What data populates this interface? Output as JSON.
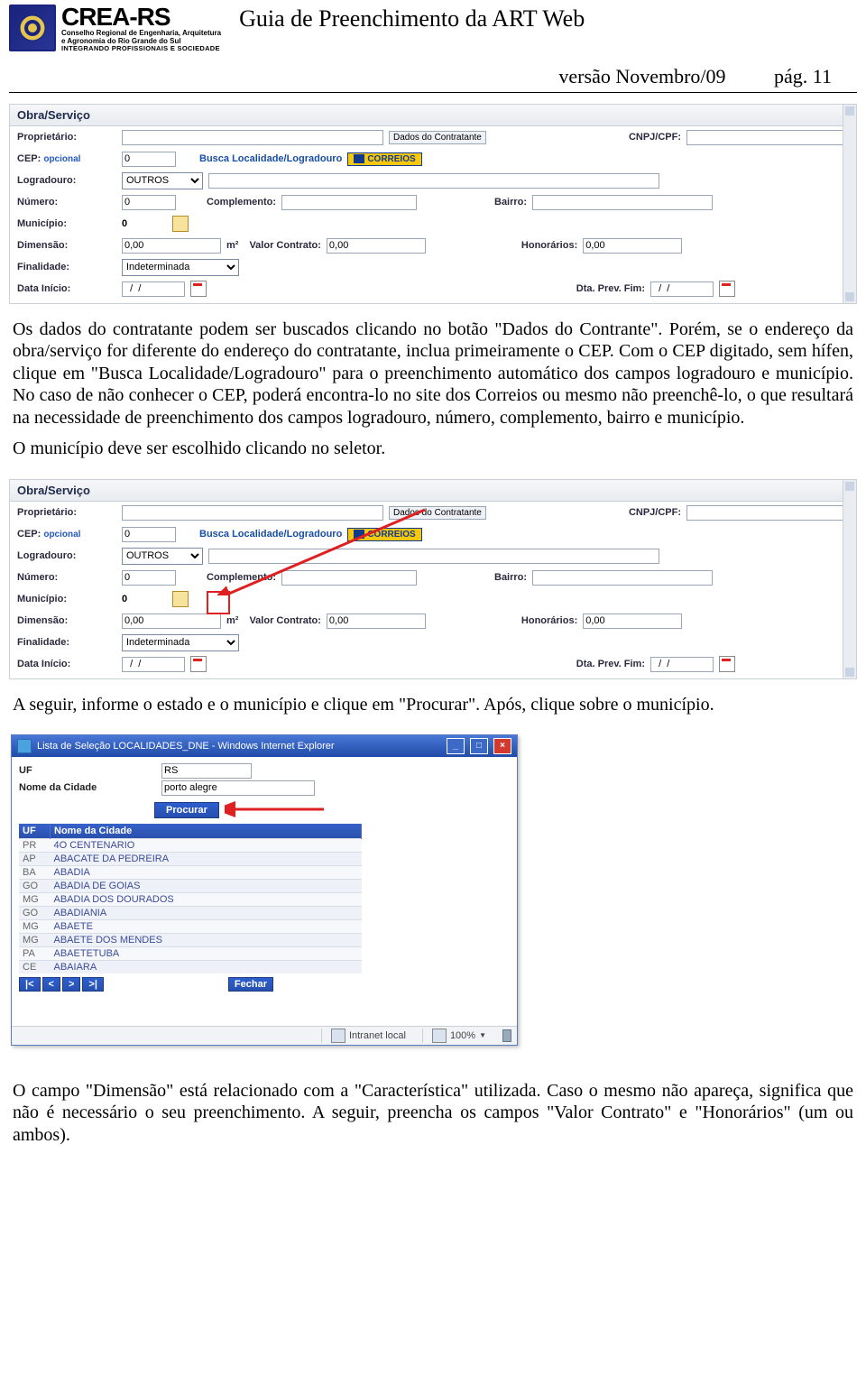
{
  "header": {
    "logo_main": "CREA-RS",
    "logo_sub1": "Conselho Regional de Engenharia, Arquitetura",
    "logo_sub2": "e Agronomia do Rio Grande do Sul",
    "logo_tagline": "INTEGRANDO PROFISSIONAIS E SOCIEDADE",
    "doc_title": "Guia de Preenchimento da ART Web",
    "version_text": "versão Novembro/09",
    "page_text": "pág. 11"
  },
  "form": {
    "section_title": "Obra/Serviço",
    "labels": {
      "proprietario": "Proprietário:",
      "cnpj_cpf": "CNPJ/CPF:",
      "cep": "CEP:",
      "cep_opt": "opcional",
      "busca_local": "Busca Localidade/Logradouro",
      "correios": "CORREIOS",
      "logradouro": "Logradouro:",
      "numero": "Número:",
      "complemento": "Complemento:",
      "bairro": "Bairro:",
      "municipio": "Município:",
      "dimensao": "Dimensão:",
      "m2": "m²",
      "valor_contrato": "Valor Contrato:",
      "honorarios": "Honorários:",
      "finalidade": "Finalidade:",
      "data_inicio": "Data Início:",
      "dta_prev_fim": "Dta. Prev. Fim:",
      "dados_contratante": "Dados do Contratante"
    },
    "values": {
      "cep": "0",
      "logradouro_tipo": "OUTROS",
      "numero": "0",
      "municipio": "0",
      "dimensao": "0,00",
      "valor_contrato": "0,00",
      "honorarios": "0,00",
      "finalidade": "Indeterminada",
      "data_inicio": "  /  /",
      "dta_prev_fim": "  /  /"
    }
  },
  "paragraphs": {
    "p1": "Os dados do contratante podem ser buscados clicando no botão \"Dados do Contrante\". Porém, se o endereço da obra/serviço for diferente do endereço do contratante, inclua primeiramente o CEP. Com o CEP digitado, sem hífen, clique em \"Busca Localidade/Logradouro\" para o preenchimento automático dos campos logradouro e município. No caso de não conhecer o CEP, poderá encontra-lo no site dos Correios ou mesmo não preenchê-lo, o que resultará na necessidade de preenchimento dos campos logradouro, número, complemento, bairro e município.",
    "p2": "O município deve ser escolhido clicando no seletor.",
    "p3": "A seguir, informe o estado e o município e clique em \"Procurar\".  Após, clique sobre o município.",
    "p4": "O campo \"Dimensão\" está relacionado com a \"Característica\" utilizada. Caso o mesmo não apareça, significa que não é necessário o seu preenchimento. A seguir, preencha os campos \"Valor Contrato\" e \"Honorários\" (um ou ambos)."
  },
  "popup": {
    "title": "Lista de Seleção LOCALIDADES_DNE - Windows Internet Explorer",
    "labels": {
      "uf": "UF",
      "nome_cidade": "Nome da Cidade",
      "procurar": "Procurar",
      "fechar": "Fechar"
    },
    "values": {
      "uf": "RS",
      "nome_cidade": "porto alegre"
    },
    "headers": [
      "UF",
      "Nome da Cidade"
    ],
    "rows": [
      [
        "PR",
        "4O CENTENARIO"
      ],
      [
        "AP",
        "ABACATE DA PEDREIRA"
      ],
      [
        "BA",
        "ABADIA"
      ],
      [
        "GO",
        "ABADIA DE GOIAS"
      ],
      [
        "MG",
        "ABADIA DOS DOURADOS"
      ],
      [
        "GO",
        "ABADIANIA"
      ],
      [
        "MG",
        "ABAETE"
      ],
      [
        "MG",
        "ABAETE DOS MENDES"
      ],
      [
        "PA",
        "ABAETETUBA"
      ],
      [
        "CE",
        "ABAIARA"
      ]
    ],
    "pager": [
      "|<",
      "<",
      ">",
      ">|"
    ],
    "status": {
      "intranet": "Intranet local",
      "zoom": "100%"
    }
  }
}
